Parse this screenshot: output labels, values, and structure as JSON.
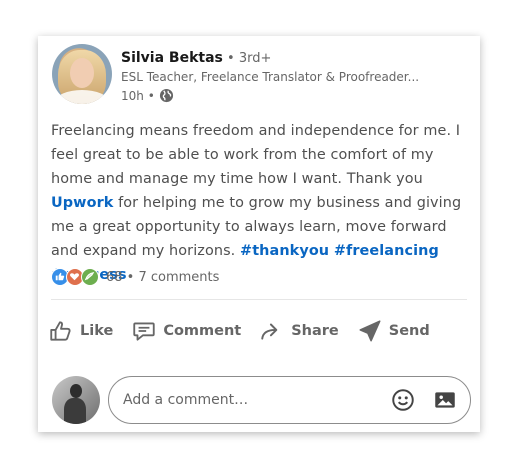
{
  "post": {
    "author_name": "Silvia Bektas",
    "degree": " • 3rd+",
    "headline": "ESL Teacher, Freelance Translator & Proofreader...",
    "time": "10h •",
    "text_1": "Freelancing means freedom and independence for me. I feel great to be able to work from the comfort of my home and manage my time how I want. Thank you ",
    "mention": "Upwork",
    "text_2": " for helping me to grow my business and giving me a great opportunity to always learn, move forward and expand my horizons. ",
    "hashtags": [
      "#thankyou",
      "#freelancing",
      "#success"
    ]
  },
  "social": {
    "reaction_count": "68",
    "comments": " • 7 comments",
    "reaction_icons": [
      "like-icon",
      "love-icon",
      "support-icon"
    ],
    "colors": {
      "like": "#378fe9",
      "love": "#df704d",
      "support": "#6dae4f"
    }
  },
  "actions": {
    "like": "Like",
    "comment": "Comment",
    "share": "Share",
    "send": "Send"
  },
  "comment_input": {
    "placeholder": "Add a comment…"
  },
  "theme": {
    "link_color": "#0a66c2",
    "text_color": "#4f4f4f",
    "muted": "#666666"
  }
}
